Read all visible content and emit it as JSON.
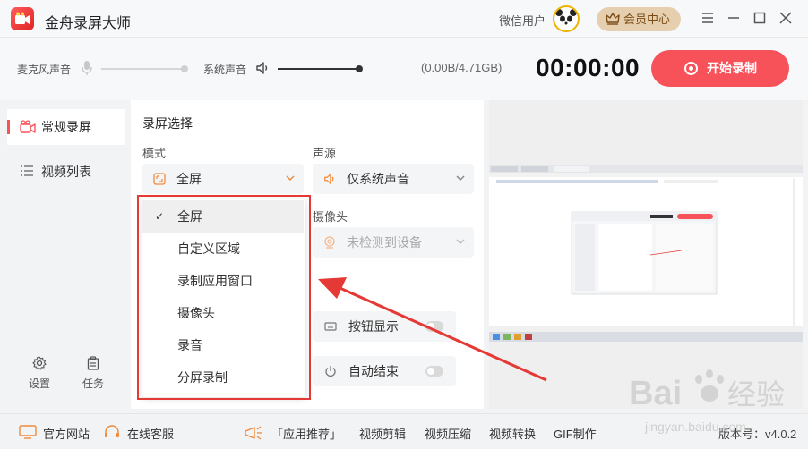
{
  "app": {
    "title": "金舟录屏大师",
    "accent": "#f7525a"
  },
  "header": {
    "user_name": "微信用户",
    "member_label": "会员中心",
    "member_icon": "crown-icon"
  },
  "toolbar": {
    "mic_label": "麦克风声音",
    "system_label": "系统声音",
    "storage": "(0.00B/4.71GB)",
    "timer": "00:00:00",
    "record_label": "开始录制"
  },
  "sidebar": {
    "items": [
      {
        "label": "常规录屏",
        "icon": "camera-icon",
        "active": true
      },
      {
        "label": "视频列表",
        "icon": "list-icon",
        "active": false
      }
    ],
    "bottom": [
      {
        "label": "设置",
        "icon": "gear-icon"
      },
      {
        "label": "任务",
        "icon": "clipboard-icon"
      }
    ]
  },
  "main": {
    "section_title": "录屏选择",
    "mode_label": "模式",
    "mode_value": "全屏",
    "audio_label": "声源",
    "audio_value": "仅系统声音",
    "camera_label": "摄像头",
    "camera_value": "未检测到设备",
    "toggles": [
      {
        "label": "按钮显示",
        "icon": "keyboard-icon",
        "on": false
      },
      {
        "label": "自动结束",
        "icon": "power-icon",
        "on": false
      }
    ]
  },
  "dropdown": {
    "options": [
      "全屏",
      "自定义区域",
      "录制应用窗口",
      "摄像头",
      "录音",
      "分屏录制"
    ],
    "selected_index": 0,
    "check": "✓"
  },
  "footer": {
    "links": [
      "官方网站",
      "在线客服",
      "「应用推荐」",
      "视频剪辑",
      "视频压缩",
      "视频转换",
      "GIF制作"
    ],
    "version": "版本号：v4.0.2"
  },
  "watermark": {
    "text": "Bai经验",
    "url": "jingyan.baidu.com"
  }
}
